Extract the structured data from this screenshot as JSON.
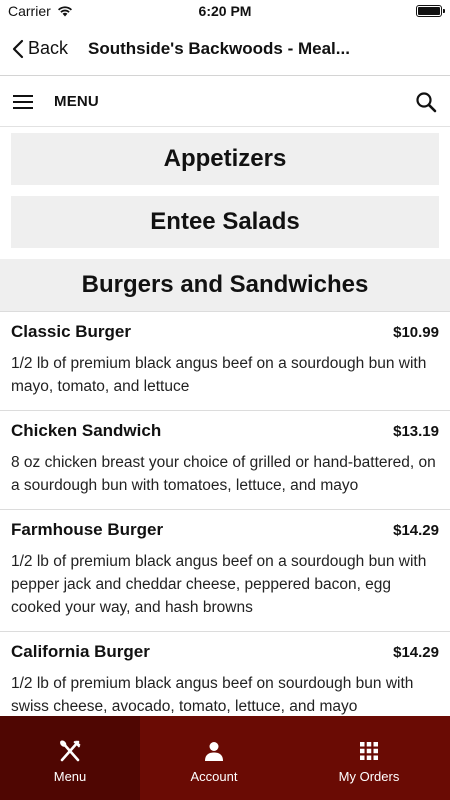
{
  "status": {
    "carrier": "Carrier",
    "time": "6:20 PM"
  },
  "nav": {
    "back_label": "Back",
    "title": "Southside's Backwoods - Meal..."
  },
  "menu_header": {
    "label": "MENU"
  },
  "categories": [
    {
      "label": "Appetizers"
    },
    {
      "label": "Entee Salads"
    }
  ],
  "section": {
    "title": "Burgers and Sandwiches"
  },
  "items": [
    {
      "name": "Classic Burger",
      "price": "$10.99",
      "description": "1/2 lb of premium black angus beef on a sourdough bun with mayo, tomato, and lettuce"
    },
    {
      "name": "Chicken Sandwich",
      "price": "$13.19",
      "description": "8 oz chicken breast your choice of grilled or hand-battered, on a sourdough bun with tomatoes, lettuce, and mayo"
    },
    {
      "name": "Farmhouse Burger",
      "price": "$14.29",
      "description": "1/2 lb of premium black angus beef on a sourdough bun with pepper jack and cheddar cheese, peppered bacon, egg cooked your way, and hash browns"
    },
    {
      "name": "California Burger",
      "price": "$14.29",
      "description": "1/2 lb of premium black angus beef on sourdough bun with swiss cheese, avocado, tomato, lettuce, and mayo"
    }
  ],
  "tabs": [
    {
      "label": "Menu",
      "icon": "fork-knife-icon",
      "active": true
    },
    {
      "label": "Account",
      "icon": "person-icon",
      "active": false
    },
    {
      "label": "My Orders",
      "icon": "grid-icon",
      "active": false
    }
  ],
  "colors": {
    "tab_bar": "#6a0b04",
    "tab_active": "#4f0602",
    "category_bg": "#efefef"
  }
}
